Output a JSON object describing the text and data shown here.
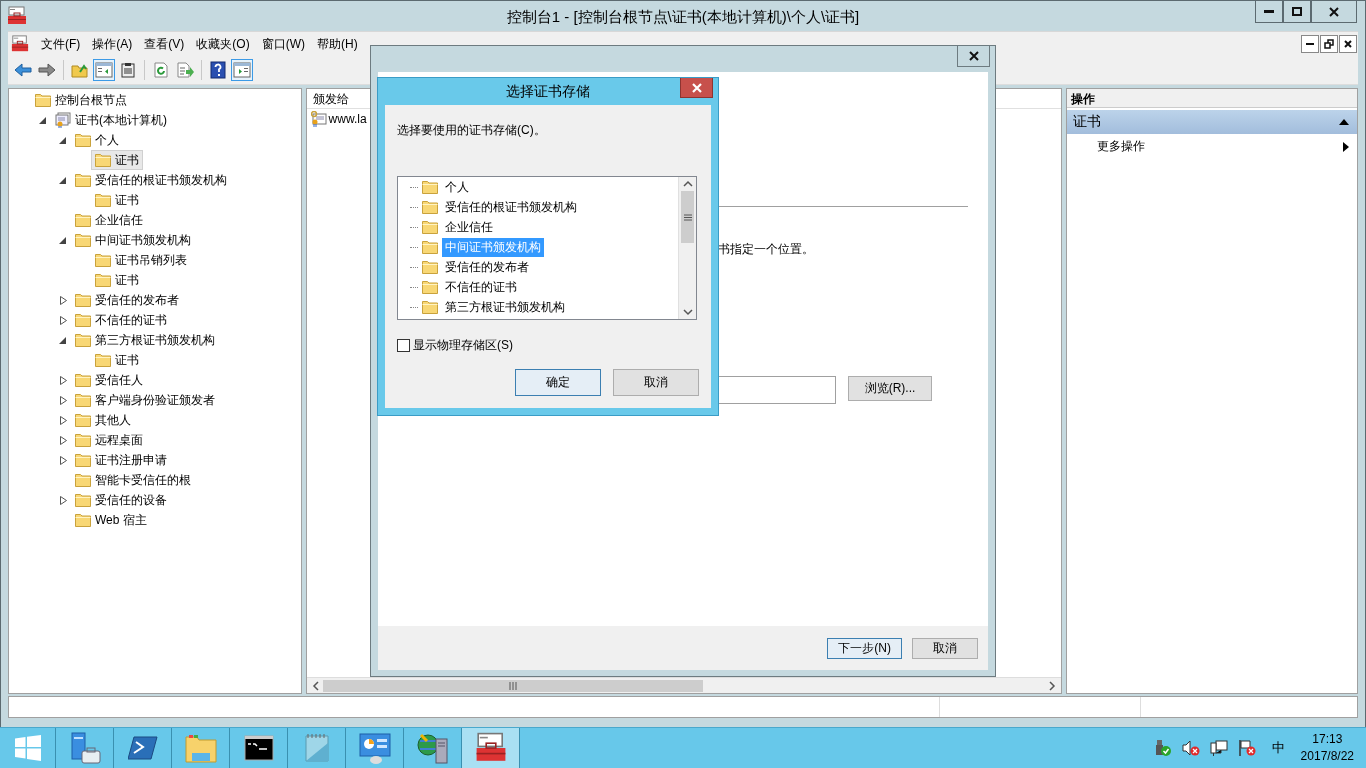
{
  "window": {
    "title": "控制台1 - [控制台根节点\\证书(本地计算机)\\个人\\证书]"
  },
  "menu": [
    "文件(F)",
    "操作(A)",
    "查看(V)",
    "收藏夹(O)",
    "窗口(W)",
    "帮助(H)"
  ],
  "toolbar": [
    [
      {
        "kind": "back",
        "pressed": false
      },
      {
        "kind": "forward",
        "pressed": false
      }
    ],
    [
      {
        "kind": "up",
        "pressed": false
      },
      {
        "kind": "tree",
        "pressed": true
      },
      {
        "kind": "clipboard",
        "pressed": false
      }
    ],
    [
      {
        "kind": "refresh",
        "pressed": false
      },
      {
        "kind": "export",
        "pressed": false
      }
    ],
    [
      {
        "kind": "help",
        "pressed": false
      },
      {
        "kind": "action-pane",
        "pressed": true
      }
    ]
  ],
  "tree": [
    {
      "label": "控制台根节点",
      "kind": "folder",
      "selected": false,
      "children": [
        {
          "label": "证书(本地计算机)",
          "kind": "store",
          "expanded": true,
          "selected": false,
          "children": [
            {
              "label": "个人",
              "kind": "folder",
              "expanded": true,
              "selected": false,
              "children": [
                {
                  "label": "证书",
                  "kind": "folder",
                  "selected": true
                }
              ]
            },
            {
              "label": "受信任的根证书颁发机构",
              "kind": "folder",
              "expanded": true,
              "selected": false,
              "children": [
                {
                  "label": "证书",
                  "kind": "folder",
                  "selected": false
                }
              ]
            },
            {
              "label": "企业信任",
              "kind": "folder",
              "selected": false
            },
            {
              "label": "中间证书颁发机构",
              "kind": "folder",
              "expanded": true,
              "selected": false,
              "children": [
                {
                  "label": "证书吊销列表",
                  "kind": "folder",
                  "selected": false
                },
                {
                  "label": "证书",
                  "kind": "folder",
                  "selected": false
                }
              ]
            },
            {
              "label": "受信任的发布者",
              "kind": "folder",
              "expanded": false,
              "selected": false
            },
            {
              "label": "不信任的证书",
              "kind": "folder",
              "expanded": false,
              "selected": false
            },
            {
              "label": "第三方根证书颁发机构",
              "kind": "folder",
              "expanded": true,
              "selected": false,
              "children": [
                {
                  "label": "证书",
                  "kind": "folder",
                  "selected": false
                }
              ]
            },
            {
              "label": "受信任人",
              "kind": "folder",
              "expanded": false,
              "selected": false
            },
            {
              "label": "客户端身份验证颁发者",
              "kind": "folder",
              "expanded": false,
              "selected": false
            },
            {
              "label": "其他人",
              "kind": "folder",
              "expanded": false,
              "selected": false
            },
            {
              "label": "远程桌面",
              "kind": "folder",
              "expanded": false,
              "selected": false
            },
            {
              "label": "证书注册申请",
              "kind": "folder",
              "expanded": false,
              "selected": false
            },
            {
              "label": "智能卡受信任的根",
              "kind": "folder",
              "selected": false
            },
            {
              "label": "受信任的设备",
              "kind": "folder",
              "expanded": false,
              "selected": false
            },
            {
              "label": "Web 宿主",
              "kind": "folder",
              "selected": false
            }
          ]
        }
      ]
    }
  ],
  "list": {
    "columns": [
      "颁发给"
    ],
    "rows": [
      "www.la"
    ]
  },
  "actions": {
    "header": "操作",
    "section": {
      "title": "证书",
      "expanded": true
    },
    "items": [
      "更多操作"
    ]
  },
  "wizard": {
    "instruction": "书指定一个位置。",
    "browse_button": "浏览(R)...",
    "buttons": [
      {
        "label": "下一步(N)",
        "default": true
      },
      {
        "label": "取消",
        "default": false
      }
    ]
  },
  "dialog": {
    "title": "选择证书存储",
    "prompt": "选择要使用的证书存储(C)。",
    "stores": [
      {
        "label": "个人",
        "selected": false
      },
      {
        "label": "受信任的根证书颁发机构",
        "selected": false
      },
      {
        "label": "企业信任",
        "selected": false
      },
      {
        "label": "中间证书颁发机构",
        "selected": true
      },
      {
        "label": "受信任的发布者",
        "selected": false
      },
      {
        "label": "不信任的证书",
        "selected": false
      },
      {
        "label": "第三方根证书颁发机构",
        "selected": false
      }
    ],
    "show_physical": {
      "label": "显示物理存储区(S)",
      "checked": false
    },
    "buttons": [
      {
        "label": "确定",
        "default": true
      },
      {
        "label": "取消",
        "default": false
      }
    ]
  },
  "taskbar": {
    "apps": [
      {
        "kind": "server-manager",
        "active": false
      },
      {
        "kind": "powershell",
        "active": false
      },
      {
        "kind": "explorer",
        "active": false
      },
      {
        "kind": "cmd",
        "active": false
      },
      {
        "kind": "notepad",
        "active": false
      },
      {
        "kind": "control-panel",
        "active": false
      },
      {
        "kind": "network",
        "active": false
      },
      {
        "kind": "mmc",
        "active": true
      }
    ],
    "tray": {
      "ime": "中",
      "time": "17:13",
      "date": "2017/8/22"
    }
  }
}
